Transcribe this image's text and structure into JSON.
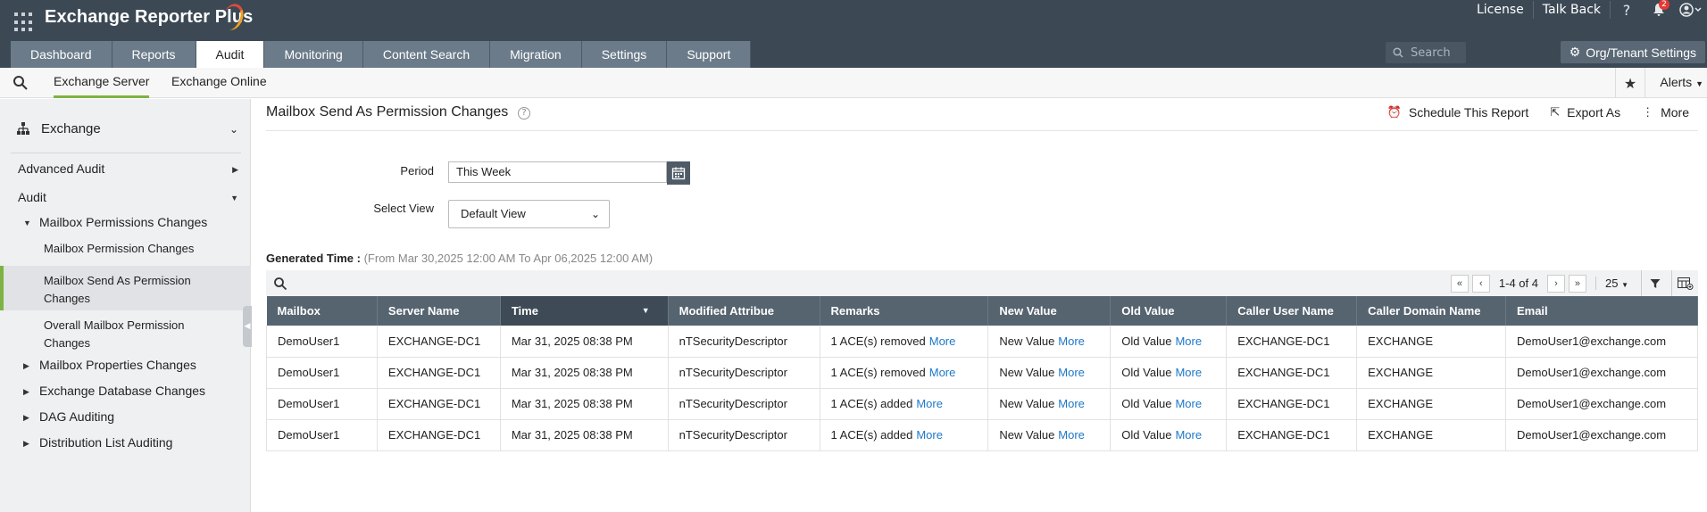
{
  "app": {
    "title": "Exchange Reporter Plus"
  },
  "toplinks": {
    "license": "License",
    "talkback": "Talk Back",
    "notification_count": "2"
  },
  "tabs": [
    {
      "label": "Dashboard"
    },
    {
      "label": "Reports"
    },
    {
      "label": "Audit",
      "active": true
    },
    {
      "label": "Monitoring"
    },
    {
      "label": "Content Search"
    },
    {
      "label": "Migration"
    },
    {
      "label": "Settings"
    },
    {
      "label": "Support"
    }
  ],
  "search": {
    "placeholder": "Search"
  },
  "org_settings": {
    "label": "Org/Tenant Settings"
  },
  "subnav": {
    "exchange_server": "Exchange Server",
    "exchange_online": "Exchange Online",
    "alerts": "Alerts"
  },
  "sidebar": {
    "root": "Exchange",
    "advanced_audit": "Advanced Audit",
    "audit": "Audit",
    "mailbox_permissions_changes": "Mailbox Permissions Changes",
    "mailbox_permission_changes": "Mailbox Permission Changes",
    "mailbox_send_as_line1": "Mailbox Send As Permission",
    "mailbox_send_as_line2": "Changes",
    "overall_line1": "Overall Mailbox Permission",
    "overall_line2": "Changes",
    "mailbox_properties_changes": "Mailbox Properties Changes",
    "exchange_database_changes": "Exchange Database Changes",
    "dag_auditing": "DAG Auditing",
    "distribution_list_auditing": "Distribution List Auditing"
  },
  "report": {
    "title": "Mailbox Send As Permission Changes",
    "schedule": "Schedule This Report",
    "export": "Export As",
    "more": "More",
    "period_label": "Period",
    "period_value": "This Week",
    "view_label": "Select View",
    "view_value": "Default View",
    "generated_label": "Generated Time :",
    "generated_range": "(From Mar 30,2025 12:00 AM To Apr 06,2025 12:00 AM)",
    "pager_text": "1-4 of 4",
    "page_size": "25"
  },
  "table": {
    "headers": [
      "Mailbox",
      "Server Name",
      "Time",
      "Modified Attribue",
      "Remarks",
      "New Value",
      "Old Value",
      "Caller User Name",
      "Caller Domain Name",
      "Email"
    ],
    "more_label": "More",
    "rows": [
      {
        "mailbox": "DemoUser1",
        "server": "EXCHANGE-DC1",
        "time": "Mar 31, 2025 08:38 PM",
        "attr": "nTSecurityDescriptor",
        "remarks": "1 ACE(s) removed",
        "new_value": "New Value",
        "old_value": "Old Value",
        "caller_user": "EXCHANGE-DC1",
        "caller_domain": "EXCHANGE",
        "email": "DemoUser1@exchange.com"
      },
      {
        "mailbox": "DemoUser1",
        "server": "EXCHANGE-DC1",
        "time": "Mar 31, 2025 08:38 PM",
        "attr": "nTSecurityDescriptor",
        "remarks": "1 ACE(s) removed",
        "new_value": "New Value",
        "old_value": "Old Value",
        "caller_user": "EXCHANGE-DC1",
        "caller_domain": "EXCHANGE",
        "email": "DemoUser1@exchange.com"
      },
      {
        "mailbox": "DemoUser1",
        "server": "EXCHANGE-DC1",
        "time": "Mar 31, 2025 08:38 PM",
        "attr": "nTSecurityDescriptor",
        "remarks": "1 ACE(s) added",
        "new_value": "New Value",
        "old_value": "Old Value",
        "caller_user": "EXCHANGE-DC1",
        "caller_domain": "EXCHANGE",
        "email": "DemoUser1@exchange.com"
      },
      {
        "mailbox": "DemoUser1",
        "server": "EXCHANGE-DC1",
        "time": "Mar 31, 2025 08:38 PM",
        "attr": "nTSecurityDescriptor",
        "remarks": "1 ACE(s) added",
        "new_value": "New Value",
        "old_value": "Old Value",
        "caller_user": "EXCHANGE-DC1",
        "caller_domain": "EXCHANGE",
        "email": "DemoUser1@exchange.com"
      }
    ]
  },
  "colors": {
    "header_bg": "#3c4955",
    "accent": "#7cb342",
    "link": "#1d78c8",
    "table_header": "#566470"
  }
}
